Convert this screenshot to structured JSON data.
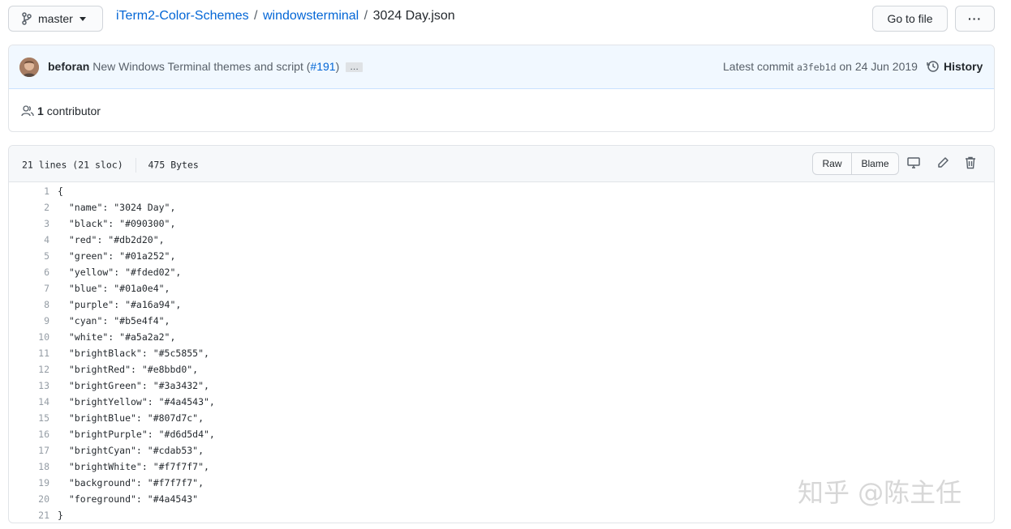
{
  "branch": {
    "icon": "git-branch-icon",
    "label": "master"
  },
  "breadcrumb": {
    "repo": "iTerm2-Color-Schemes",
    "sep1": "/",
    "folder": "windowsterminal",
    "sep2": "/",
    "file": "3024 Day.json"
  },
  "actions": {
    "go_to_file": "Go to file",
    "more": "···"
  },
  "commit": {
    "author": "beforan",
    "message": "New Windows Terminal themes and script (",
    "pr": "#191",
    "close_paren": ")",
    "ellipsis": "…",
    "latest_label": "Latest commit",
    "sha": "a3feb1d",
    "date": "on 24 Jun 2019",
    "history": "History"
  },
  "contributors": {
    "count": "1",
    "label": "contributor"
  },
  "file_info": {
    "lines": "21 lines (21 sloc)",
    "size": "475 Bytes"
  },
  "file_actions": {
    "raw": "Raw",
    "blame": "Blame"
  },
  "code_lines": [
    "{",
    "  \"name\": \"3024 Day\",",
    "  \"black\": \"#090300\",",
    "  \"red\": \"#db2d20\",",
    "  \"green\": \"#01a252\",",
    "  \"yellow\": \"#fded02\",",
    "  \"blue\": \"#01a0e4\",",
    "  \"purple\": \"#a16a94\",",
    "  \"cyan\": \"#b5e4f4\",",
    "  \"white\": \"#a5a2a2\",",
    "  \"brightBlack\": \"#5c5855\",",
    "  \"brightRed\": \"#e8bbd0\",",
    "  \"brightGreen\": \"#3a3432\",",
    "  \"brightYellow\": \"#4a4543\",",
    "  \"brightBlue\": \"#807d7c\",",
    "  \"brightPurple\": \"#d6d5d4\",",
    "  \"brightCyan\": \"#cdab53\",",
    "  \"brightWhite\": \"#f7f7f7\",",
    "  \"background\": \"#f7f7f7\",",
    "  \"foreground\": \"#4a4543\"",
    "}"
  ],
  "watermark": "知乎 @陈主任",
  "colors": {
    "link": "#0366d6",
    "commit_bg": "#f1f8ff",
    "border": "#e1e4e8"
  }
}
